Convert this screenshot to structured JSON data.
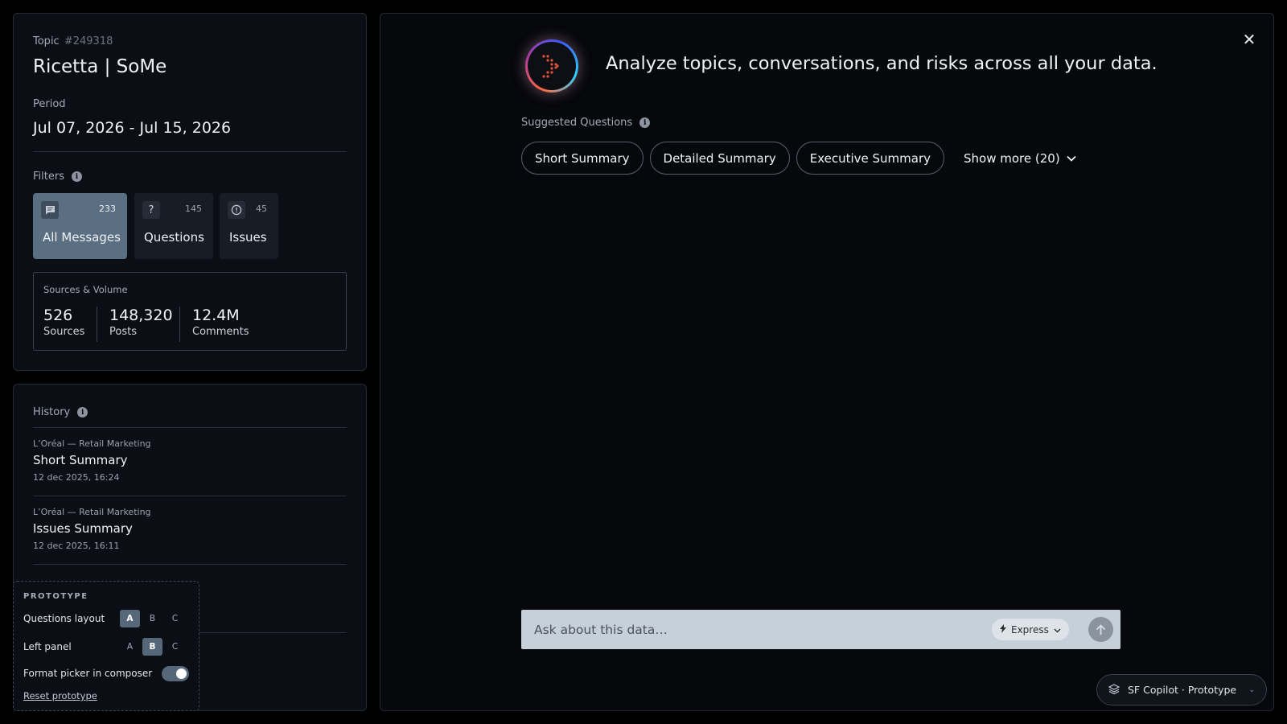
{
  "topic": {
    "label": "Topic",
    "id": "#249318",
    "title": "Ricetta | SoMe",
    "period_label": "Period",
    "period_value": "Jul 07, 2026 - Jul 15, 2026",
    "filters_label": "Filters",
    "filters": [
      {
        "label": "All Messages",
        "count": "233",
        "icon": "message-icon",
        "active": true
      },
      {
        "label": "Questions",
        "count": "145",
        "icon": "question-icon",
        "active": false
      },
      {
        "label": "Issues",
        "count": "45",
        "icon": "alert-circle-icon",
        "active": false
      }
    ],
    "sources_volume": {
      "title": "Sources & Volume",
      "stats": [
        {
          "value": "526",
          "label": "Sources"
        },
        {
          "value": "148,320",
          "label": "Posts"
        },
        {
          "value": "12.4M",
          "label": "Comments"
        }
      ]
    }
  },
  "history": {
    "label": "History",
    "items": [
      {
        "subtitle": "L’Oréal — Retail Marketing",
        "title": "Short Summary",
        "date": "12 dec 2025, 16:24"
      },
      {
        "subtitle": "L’Oréal — Retail Marketing",
        "title": "Issues Summary",
        "date": "12 dec 2025, 16:11"
      }
    ]
  },
  "prototype": {
    "title": "PROTOTYPE",
    "questions_layout_label": "Questions layout",
    "questions_layout_options": [
      "A",
      "B",
      "C"
    ],
    "questions_layout_selected": "A",
    "left_panel_label": "Left panel",
    "left_panel_options": [
      "A",
      "B",
      "C"
    ],
    "left_panel_selected": "B",
    "format_picker_label": "Format picker in composer",
    "format_picker_enabled": true,
    "reset_label": "Reset prototype"
  },
  "main": {
    "headline": "Analyze topics, conversations, and risks across all your data.",
    "suggested_label": "Suggested Questions",
    "chips": [
      "Short Summary",
      "Detailed Summary",
      "Executive Summary"
    ],
    "show_more": "Show more (20)",
    "composer": {
      "placeholder": "Ask about this data…",
      "mode_label": "Express"
    },
    "close_icon": "close-icon"
  },
  "copilot_pill": {
    "label": "SF Copilot · Prototype"
  },
  "colors": {
    "background": "#000000",
    "panel": "#0b0e15",
    "active_filter": "#5b6f83",
    "composer": "#c6d0d9",
    "toggle_on": "#566779"
  }
}
